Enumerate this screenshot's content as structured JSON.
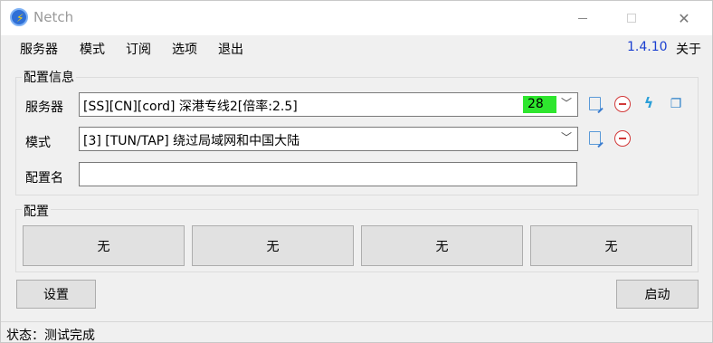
{
  "window": {
    "title": "Netch"
  },
  "menu": {
    "items": [
      "服务器",
      "模式",
      "订阅",
      "选项",
      "退出"
    ],
    "version": "1.4.10",
    "about": "关于"
  },
  "config_info": {
    "title": "配置信息",
    "server_label": "服务器",
    "server_value": "[SS][CN][cord] 深港专线2[倍率:2.5]",
    "server_delay": "28",
    "mode_label": "模式",
    "mode_value": "[3] [TUN/TAP] 绕过局域网和中国大陆",
    "profile_name_label": "配置名",
    "profile_name_value": ""
  },
  "profiles": {
    "title": "配置",
    "buttons": [
      "无",
      "无",
      "无",
      "无"
    ]
  },
  "buttons": {
    "settings": "设置",
    "start": "启动"
  },
  "status": {
    "text": "状态：测试完成"
  },
  "colors": {
    "delay_bg": "#2ee62e",
    "version": "#1a3fd0"
  }
}
